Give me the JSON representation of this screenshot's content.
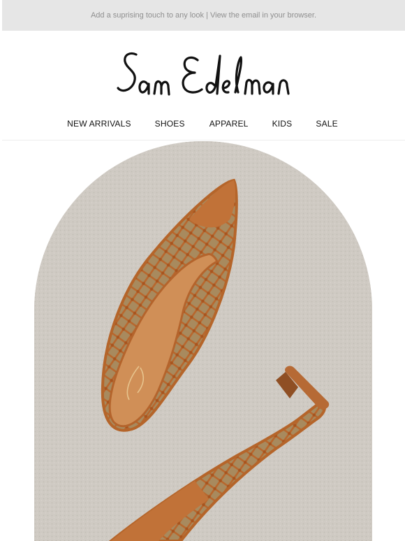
{
  "preheader": {
    "text": "Add a suprising touch to any look | View the email in your browser."
  },
  "brand": {
    "logo_text": "Sam Edelman"
  },
  "nav": {
    "items": [
      {
        "label": "NEW ARRIVALS"
      },
      {
        "label": "SHOES"
      },
      {
        "label": "APPAREL"
      },
      {
        "label": "KIDS"
      },
      {
        "label": "SALE"
      }
    ]
  },
  "hero": {
    "image": "tan-woven-mule-heels-on-carpet",
    "colors": {
      "carpet": "#cfcac3",
      "leather": "#c0773e",
      "insole": "#d08f57"
    }
  }
}
